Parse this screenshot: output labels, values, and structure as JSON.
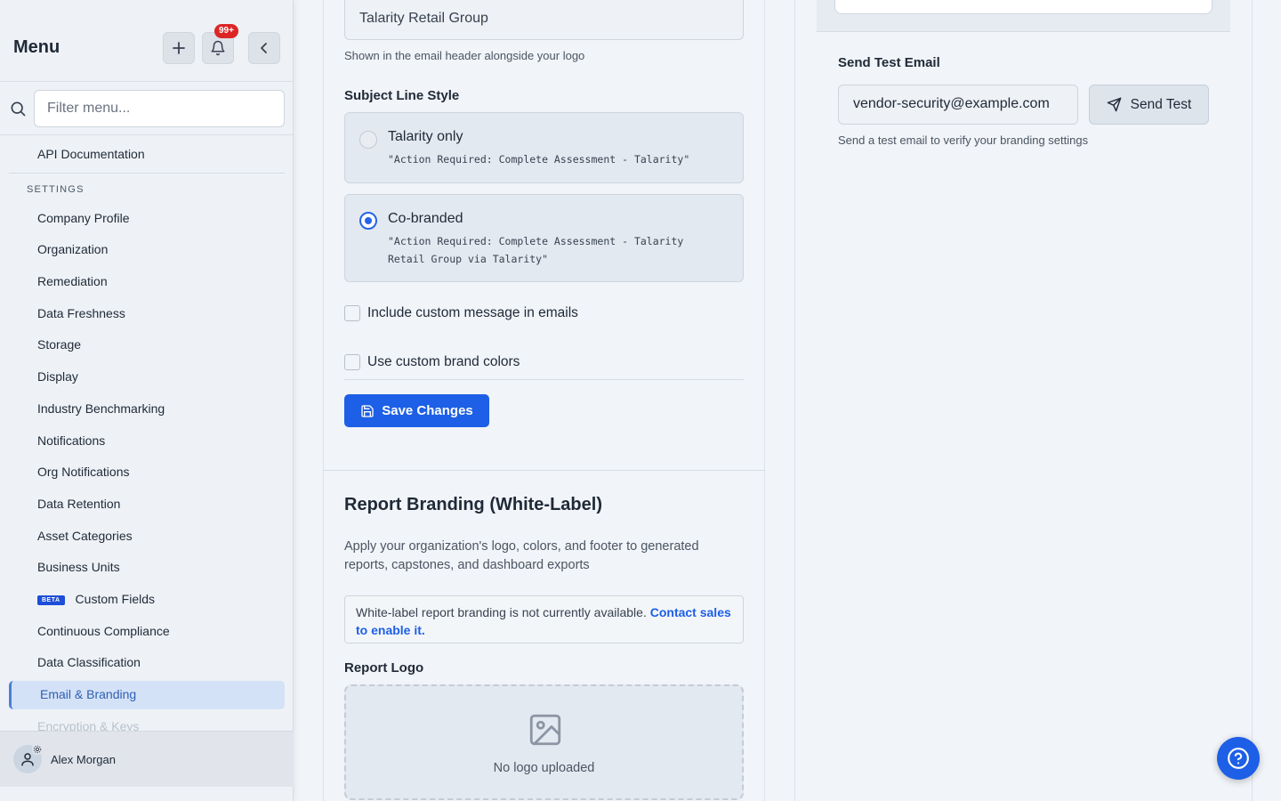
{
  "sidebar": {
    "title": "Menu",
    "notifications_badge": "99+",
    "filter_placeholder": "Filter menu...",
    "top_item": "API Documentation",
    "section_label": "SETTINGS",
    "items": [
      "Company Profile",
      "Organization",
      "Remediation",
      "Data Freshness",
      "Storage",
      "Display",
      "Industry Benchmarking",
      "Notifications",
      "Org Notifications",
      "Data Retention",
      "Asset Categories",
      "Business Units",
      "Custom Fields",
      "Continuous Compliance",
      "Data Classification",
      "Email & Branding",
      "Encryption & Keys"
    ],
    "beta_label": "BETA",
    "active_item": "Email & Branding",
    "user_name": "Alex Morgan"
  },
  "email_branding": {
    "display_name_value": "Talarity Retail Group",
    "display_name_help": "Shown in the email header alongside your logo",
    "subject_label": "Subject Line Style",
    "options": [
      {
        "title": "Talarity only",
        "example": "\"Action Required: Complete Assessment - Talarity\"",
        "selected": false
      },
      {
        "title": "Co-branded",
        "example": "\"Action Required: Complete Assessment - Talarity Retail Group via Talarity\"",
        "selected": true
      }
    ],
    "checkbox_custom_message": "Include custom message in emails",
    "checkbox_brand_colors": "Use custom brand colors",
    "save_label": "Save Changes"
  },
  "report_branding": {
    "title": "Report Branding (White-Label)",
    "description": "Apply your organization's logo, colors, and footer to generated reports, capstones, and dashboard exports",
    "notice_text": "White-label report branding is not currently available.",
    "notice_link": "Contact sales to enable it.",
    "logo_label": "Report Logo",
    "logo_empty": "No logo uploaded"
  },
  "test_email": {
    "label": "Send Test Email",
    "email_value": "vendor-security@example.com",
    "send_label": "Send Test",
    "help": "Send a test email to verify your branding settings"
  },
  "colors": {
    "accent": "#1d5fe6",
    "badge": "#dc2626",
    "active_bg": "#d4e2f7"
  }
}
